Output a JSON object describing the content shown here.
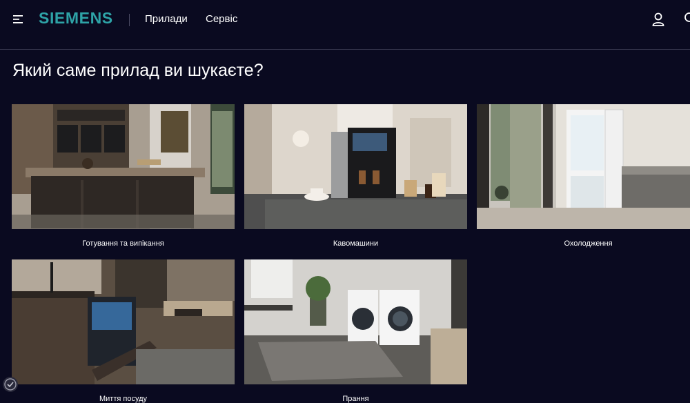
{
  "header": {
    "logo": "SIEMENS",
    "nav": [
      {
        "label": "Прилади"
      },
      {
        "label": "Сервіс"
      }
    ],
    "icons": [
      "menu-icon",
      "user-icon",
      "search-icon"
    ]
  },
  "main": {
    "title": "Який саме прилад ви шукаєте?",
    "categories": [
      {
        "label": "Готування та випікання",
        "image": "kitchen-ovens-image"
      },
      {
        "label": "Кавомашини",
        "image": "coffee-machine-image"
      },
      {
        "label": "Охолодження",
        "image": "fridge-image"
      },
      {
        "label": "Миття посуду",
        "image": "dishwasher-image"
      },
      {
        "label": "Прання",
        "image": "washing-machine-image"
      }
    ]
  },
  "colors": {
    "background": "#0a0a20",
    "brand": "#2ea3a7",
    "text": "#ffffff"
  }
}
